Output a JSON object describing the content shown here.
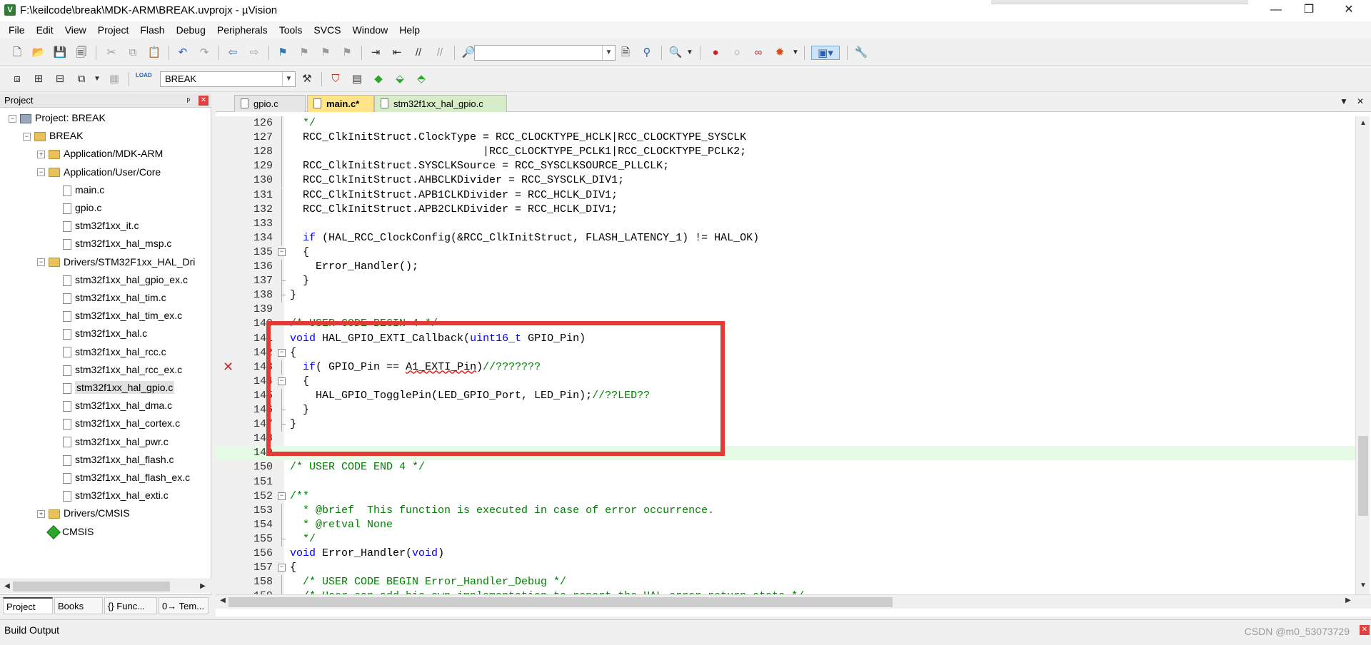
{
  "window": {
    "title": "F:\\keilcode\\break\\MDK-ARM\\BREAK.uvprojx - µVision",
    "app_icon_letter": "V",
    "minimize": "—",
    "maximize": "❐",
    "close": "✕"
  },
  "menu": [
    "File",
    "Edit",
    "View",
    "Project",
    "Flash",
    "Debug",
    "Peripherals",
    "Tools",
    "SVCS",
    "Window",
    "Help"
  ],
  "toolbar2": {
    "target_name": "BREAK",
    "load_label": "LOAD"
  },
  "project_panel": {
    "title": "Project",
    "pin": "ᵖ",
    "close": "✕",
    "tree": [
      {
        "label": "Project: BREAK",
        "indent": 0,
        "icon": "proj",
        "expander": "−"
      },
      {
        "label": "BREAK",
        "indent": 1,
        "icon": "folder",
        "expander": "−"
      },
      {
        "label": "Application/MDK-ARM",
        "indent": 2,
        "icon": "folder",
        "expander": "+"
      },
      {
        "label": "Application/User/Core",
        "indent": 2,
        "icon": "folder",
        "expander": "−"
      },
      {
        "label": "main.c",
        "indent": 3,
        "icon": "file",
        "expander": ""
      },
      {
        "label": "gpio.c",
        "indent": 3,
        "icon": "file",
        "expander": ""
      },
      {
        "label": "stm32f1xx_it.c",
        "indent": 3,
        "icon": "file",
        "expander": ""
      },
      {
        "label": "stm32f1xx_hal_msp.c",
        "indent": 3,
        "icon": "file",
        "expander": ""
      },
      {
        "label": "Drivers/STM32F1xx_HAL_Dri",
        "indent": 2,
        "icon": "folder",
        "expander": "−"
      },
      {
        "label": "stm32f1xx_hal_gpio_ex.c",
        "indent": 3,
        "icon": "file",
        "expander": ""
      },
      {
        "label": "stm32f1xx_hal_tim.c",
        "indent": 3,
        "icon": "file",
        "expander": ""
      },
      {
        "label": "stm32f1xx_hal_tim_ex.c",
        "indent": 3,
        "icon": "file",
        "expander": ""
      },
      {
        "label": "stm32f1xx_hal.c",
        "indent": 3,
        "icon": "file",
        "expander": ""
      },
      {
        "label": "stm32f1xx_hal_rcc.c",
        "indent": 3,
        "icon": "file",
        "expander": ""
      },
      {
        "label": "stm32f1xx_hal_rcc_ex.c",
        "indent": 3,
        "icon": "file",
        "expander": ""
      },
      {
        "label": "stm32f1xx_hal_gpio.c",
        "indent": 3,
        "icon": "file",
        "expander": "",
        "selected": true
      },
      {
        "label": "stm32f1xx_hal_dma.c",
        "indent": 3,
        "icon": "file",
        "expander": ""
      },
      {
        "label": "stm32f1xx_hal_cortex.c",
        "indent": 3,
        "icon": "file",
        "expander": ""
      },
      {
        "label": "stm32f1xx_hal_pwr.c",
        "indent": 3,
        "icon": "file",
        "expander": ""
      },
      {
        "label": "stm32f1xx_hal_flash.c",
        "indent": 3,
        "icon": "file",
        "expander": ""
      },
      {
        "label": "stm32f1xx_hal_flash_ex.c",
        "indent": 3,
        "icon": "file",
        "expander": ""
      },
      {
        "label": "stm32f1xx_hal_exti.c",
        "indent": 3,
        "icon": "file",
        "expander": ""
      },
      {
        "label": "Drivers/CMSIS",
        "indent": 2,
        "icon": "folder",
        "expander": "+"
      },
      {
        "label": "CMSIS",
        "indent": 2,
        "icon": "cmsis",
        "expander": ""
      }
    ],
    "tabs": [
      {
        "label": "Project",
        "active": true
      },
      {
        "label": "Books",
        "active": false
      },
      {
        "label": "{} Func...",
        "active": false
      },
      {
        "label": "0→ Tem...",
        "active": false
      }
    ]
  },
  "editor": {
    "tabs": [
      {
        "label": "gpio.c",
        "style": "normal"
      },
      {
        "label": "main.c*",
        "style": "active"
      },
      {
        "label": "stm32f1xx_hal_gpio.c",
        "style": "green"
      }
    ],
    "lines": [
      {
        "n": "126",
        "fold": "line",
        "segs": [
          {
            "t": "  */",
            "c": "cm"
          }
        ]
      },
      {
        "n": "127",
        "fold": "line",
        "segs": [
          {
            "t": "  RCC_ClkInitStruct.ClockType = RCC_CLOCKTYPE_HCLK|RCC_CLOCKTYPE_SYSCLK",
            "c": ""
          }
        ]
      },
      {
        "n": "128",
        "fold": "line",
        "segs": [
          {
            "t": "                              |RCC_CLOCKTYPE_PCLK1|RCC_CLOCKTYPE_PCLK2;",
            "c": ""
          }
        ]
      },
      {
        "n": "129",
        "fold": "line",
        "segs": [
          {
            "t": "  RCC_ClkInitStruct.SYSCLKSource = RCC_SYSCLKSOURCE_PLLCLK;",
            "c": ""
          }
        ]
      },
      {
        "n": "130",
        "fold": "line",
        "segs": [
          {
            "t": "  RCC_ClkInitStruct.AHBCLKDivider = RCC_SYSCLK_DIV1;",
            "c": ""
          }
        ]
      },
      {
        "n": "131",
        "fold": "line",
        "segs": [
          {
            "t": "  RCC_ClkInitStruct.APB1CLKDivider = RCC_HCLK_DIV1;",
            "c": ""
          }
        ]
      },
      {
        "n": "132",
        "fold": "line",
        "segs": [
          {
            "t": "  RCC_ClkInitStruct.APB2CLKDivider = RCC_HCLK_DIV1;",
            "c": ""
          }
        ]
      },
      {
        "n": "133",
        "fold": "line",
        "segs": [
          {
            "t": "",
            "c": ""
          }
        ]
      },
      {
        "n": "134",
        "fold": "line",
        "segs": [
          {
            "t": "  ",
            "c": ""
          },
          {
            "t": "if",
            "c": "kw"
          },
          {
            "t": " (HAL_RCC_ClockConfig(&RCC_ClkInitStruct, FLASH_LATENCY_1) != HAL_OK)",
            "c": ""
          }
        ]
      },
      {
        "n": "135",
        "fold": "box",
        "segs": [
          {
            "t": "  {",
            "c": ""
          }
        ]
      },
      {
        "n": "136",
        "fold": "line",
        "segs": [
          {
            "t": "    Error_Handler();",
            "c": ""
          }
        ]
      },
      {
        "n": "137",
        "fold": "end",
        "segs": [
          {
            "t": "  }",
            "c": ""
          }
        ]
      },
      {
        "n": "138",
        "fold": "end",
        "segs": [
          {
            "t": "}",
            "c": ""
          }
        ]
      },
      {
        "n": "139",
        "fold": "none",
        "segs": [
          {
            "t": "",
            "c": ""
          }
        ]
      },
      {
        "n": "140",
        "fold": "none",
        "segs": [
          {
            "t": "/* USER CODE BEGIN 4 */",
            "c": "cm"
          }
        ]
      },
      {
        "n": "141",
        "fold": "none",
        "segs": [
          {
            "t": "void",
            "c": "kw"
          },
          {
            "t": " HAL_GPIO_EXTI_Callback(",
            "c": ""
          },
          {
            "t": "uint16_t",
            "c": "kw"
          },
          {
            "t": " GPIO_Pin)",
            "c": ""
          }
        ]
      },
      {
        "n": "142",
        "fold": "box",
        "segs": [
          {
            "t": "{",
            "c": ""
          }
        ]
      },
      {
        "n": "143",
        "fold": "line",
        "err": true,
        "segs": [
          {
            "t": "  ",
            "c": ""
          },
          {
            "t": "if",
            "c": "kw"
          },
          {
            "t": "( GPIO_Pin == ",
            "c": ""
          },
          {
            "t": "A1_EXTI_Pin",
            "c": "err-ul"
          },
          {
            "t": ")",
            "c": ""
          },
          {
            "t": "//???????",
            "c": "cm"
          }
        ]
      },
      {
        "n": "144",
        "fold": "box",
        "segs": [
          {
            "t": "  {",
            "c": ""
          }
        ]
      },
      {
        "n": "145",
        "fold": "line",
        "segs": [
          {
            "t": "    HAL_GPIO_TogglePin(LED_GPIO_Port, LED_Pin);",
            "c": ""
          },
          {
            "t": "//??LED??",
            "c": "cm"
          }
        ]
      },
      {
        "n": "146",
        "fold": "end",
        "segs": [
          {
            "t": "  }",
            "c": ""
          }
        ]
      },
      {
        "n": "147",
        "fold": "end",
        "segs": [
          {
            "t": "}",
            "c": ""
          }
        ]
      },
      {
        "n": "148",
        "fold": "none",
        "segs": [
          {
            "t": "",
            "c": ""
          }
        ]
      },
      {
        "n": "149",
        "fold": "none",
        "current": true,
        "segs": [
          {
            "t": "",
            "c": ""
          }
        ]
      },
      {
        "n": "150",
        "fold": "none",
        "segs": [
          {
            "t": "/* USER CODE END 4 */",
            "c": "cm"
          }
        ]
      },
      {
        "n": "151",
        "fold": "none",
        "segs": [
          {
            "t": "",
            "c": ""
          }
        ]
      },
      {
        "n": "152",
        "fold": "box",
        "segs": [
          {
            "t": "/**",
            "c": "cm"
          }
        ]
      },
      {
        "n": "153",
        "fold": "line",
        "segs": [
          {
            "t": "  * @brief  This function is executed in case of error occurrence.",
            "c": "cm"
          }
        ]
      },
      {
        "n": "154",
        "fold": "line",
        "segs": [
          {
            "t": "  * @retval None",
            "c": "cm"
          }
        ]
      },
      {
        "n": "155",
        "fold": "end",
        "segs": [
          {
            "t": "  */",
            "c": "cm"
          }
        ]
      },
      {
        "n": "156",
        "fold": "none",
        "segs": [
          {
            "t": "void",
            "c": "kw"
          },
          {
            "t": " Error_Handler(",
            "c": ""
          },
          {
            "t": "void",
            "c": "kw"
          },
          {
            "t": ")",
            "c": ""
          }
        ]
      },
      {
        "n": "157",
        "fold": "box",
        "segs": [
          {
            "t": "{",
            "c": ""
          }
        ]
      },
      {
        "n": "158",
        "fold": "line",
        "segs": [
          {
            "t": "  /* USER CODE BEGIN Error_Handler_Debug */",
            "c": "cm"
          }
        ]
      },
      {
        "n": "159",
        "fold": "line",
        "segs": [
          {
            "t": "  /* User can add his own implementation to report the HAL error return state */",
            "c": "cm"
          }
        ]
      }
    ]
  },
  "build_output": {
    "title": "Build Output",
    "watermark": "CSDN @m0_53073729",
    "close": "✕"
  },
  "colors": {
    "keyword": "#0000ff",
    "comment": "#008000",
    "highlight_box": "#e53935",
    "active_tab": "#ffe48a"
  }
}
